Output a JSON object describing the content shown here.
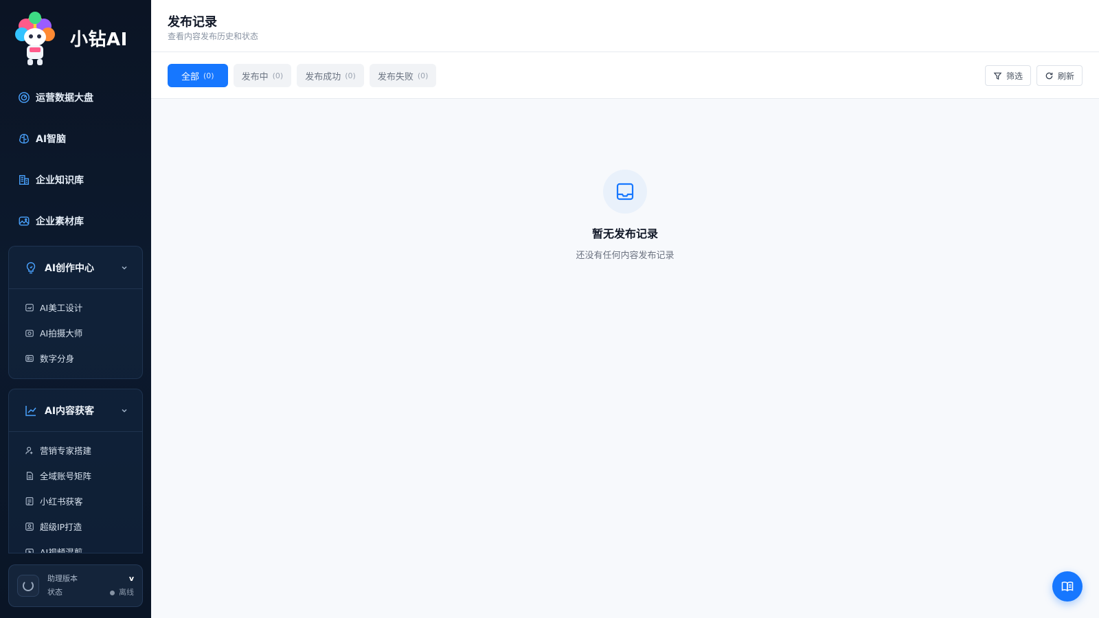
{
  "brand": {
    "name": "小钻AI",
    "logo_badge": "小钻AI"
  },
  "nav": {
    "top_items": [
      {
        "label": "运营数据大盘",
        "icon": "dashboard-icon"
      },
      {
        "label": "AI智脑",
        "icon": "brain-icon"
      },
      {
        "label": "企业知识库",
        "icon": "building-icon"
      },
      {
        "label": "企业素材库",
        "icon": "image-icon"
      }
    ],
    "groups": [
      {
        "title": "AI创作中心",
        "icon": "bulb-icon",
        "items": [
          {
            "label": "AI美工设计",
            "icon": "design-icon"
          },
          {
            "label": "AI拍摄大师",
            "icon": "camera-icon"
          },
          {
            "label": "数字分身",
            "icon": "avatar-card-icon"
          }
        ]
      },
      {
        "title": "AI内容获客",
        "icon": "trend-icon",
        "items": [
          {
            "label": "营销专家搭建",
            "icon": "user-plus-icon"
          },
          {
            "label": "全域账号矩阵",
            "icon": "document-icon"
          },
          {
            "label": "小红书获客",
            "icon": "ai-card-icon"
          },
          {
            "label": "超级IP打造",
            "icon": "ip-icon"
          },
          {
            "label": "AI视频混剪",
            "icon": "video-icon"
          }
        ]
      }
    ]
  },
  "assistant": {
    "version_label": "助理版本",
    "version_value": "v",
    "status_label": "状态",
    "status_value": "离线"
  },
  "header": {
    "title": "发布记录",
    "subtitle": "查看内容发布历史和状态"
  },
  "tabs": [
    {
      "label": "全部",
      "count": "(0)",
      "active": true
    },
    {
      "label": "发布中",
      "count": "(0)",
      "active": false
    },
    {
      "label": "发布成功",
      "count": "(0)",
      "active": false
    },
    {
      "label": "发布失败",
      "count": "(0)",
      "active": false
    }
  ],
  "toolbar": {
    "filter_label": "筛选",
    "refresh_label": "刷新"
  },
  "empty_state": {
    "title": "暂无发布记录",
    "description": "还没有任何内容发布记录"
  },
  "colors": {
    "accent": "#1677ff",
    "sidebar_bg": "#0b1424",
    "main_bg": "#f7f9fc"
  }
}
